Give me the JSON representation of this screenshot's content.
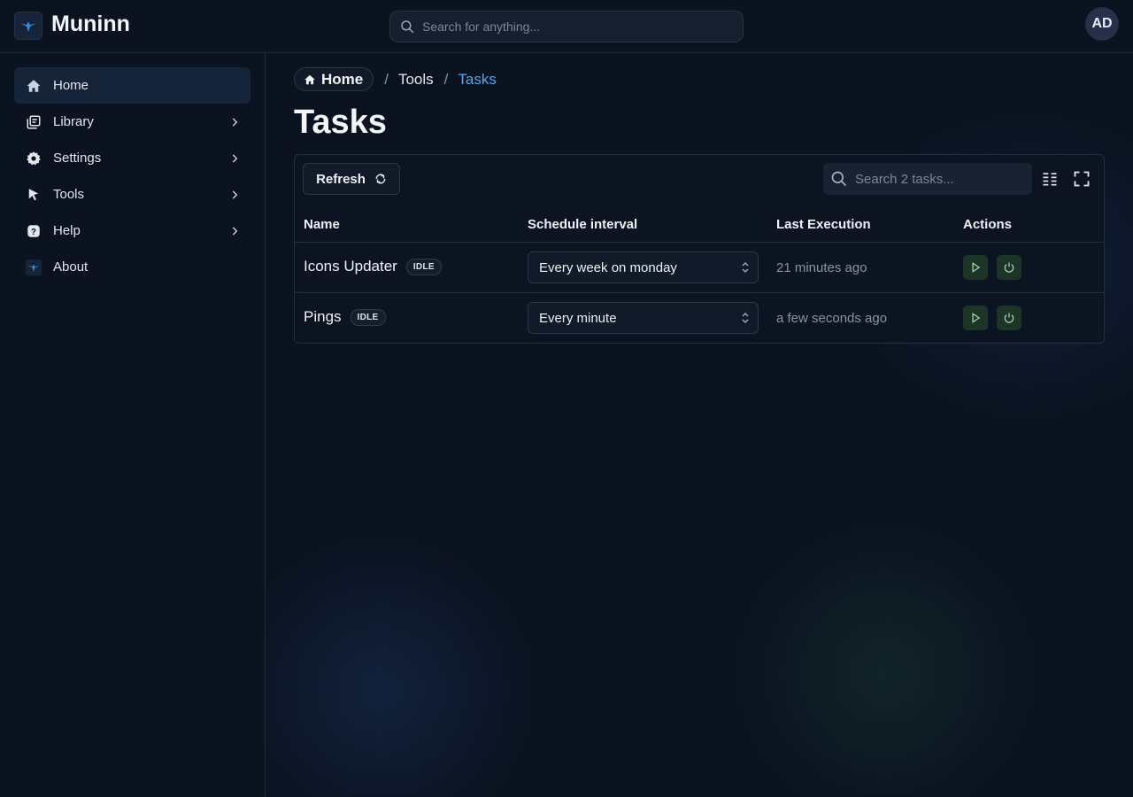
{
  "app": {
    "title": "Muninn",
    "logo_icon": "raven-logo-icon"
  },
  "header": {
    "search_placeholder": "Search for anything...",
    "avatar_initials": "AD"
  },
  "sidebar": {
    "items": [
      {
        "label": "Home",
        "icon": "home-icon",
        "active": true,
        "has_chevron": false
      },
      {
        "label": "Library",
        "icon": "library-icon",
        "active": false,
        "has_chevron": true
      },
      {
        "label": "Settings",
        "icon": "gear-icon",
        "active": false,
        "has_chevron": true
      },
      {
        "label": "Tools",
        "icon": "cursor-click-icon",
        "active": false,
        "has_chevron": true
      },
      {
        "label": "Help",
        "icon": "question-icon",
        "active": false,
        "has_chevron": true
      },
      {
        "label": "About",
        "icon": "raven-logo-icon",
        "active": false,
        "has_chevron": false
      }
    ]
  },
  "breadcrumb": {
    "home": "Home",
    "separator": "/",
    "tools": "Tools",
    "current": "Tasks"
  },
  "page": {
    "title": "Tasks"
  },
  "toolbar": {
    "refresh_label": "Refresh",
    "search_placeholder": "Search 2 tasks..."
  },
  "table": {
    "columns": [
      "Name",
      "Schedule interval",
      "Last Execution",
      "Actions"
    ],
    "rows": [
      {
        "name": "Icons Updater",
        "status": "IDLE",
        "interval": "Every week on monday",
        "last_execution": "21 minutes ago"
      },
      {
        "name": "Pings",
        "status": "IDLE",
        "interval": "Every minute",
        "last_execution": "a few seconds ago"
      }
    ]
  },
  "colors": {
    "background": "#0b1220",
    "accent": "#5aa5e6",
    "action_button": "#1d3528",
    "action_icon": "#9fd6a8"
  }
}
